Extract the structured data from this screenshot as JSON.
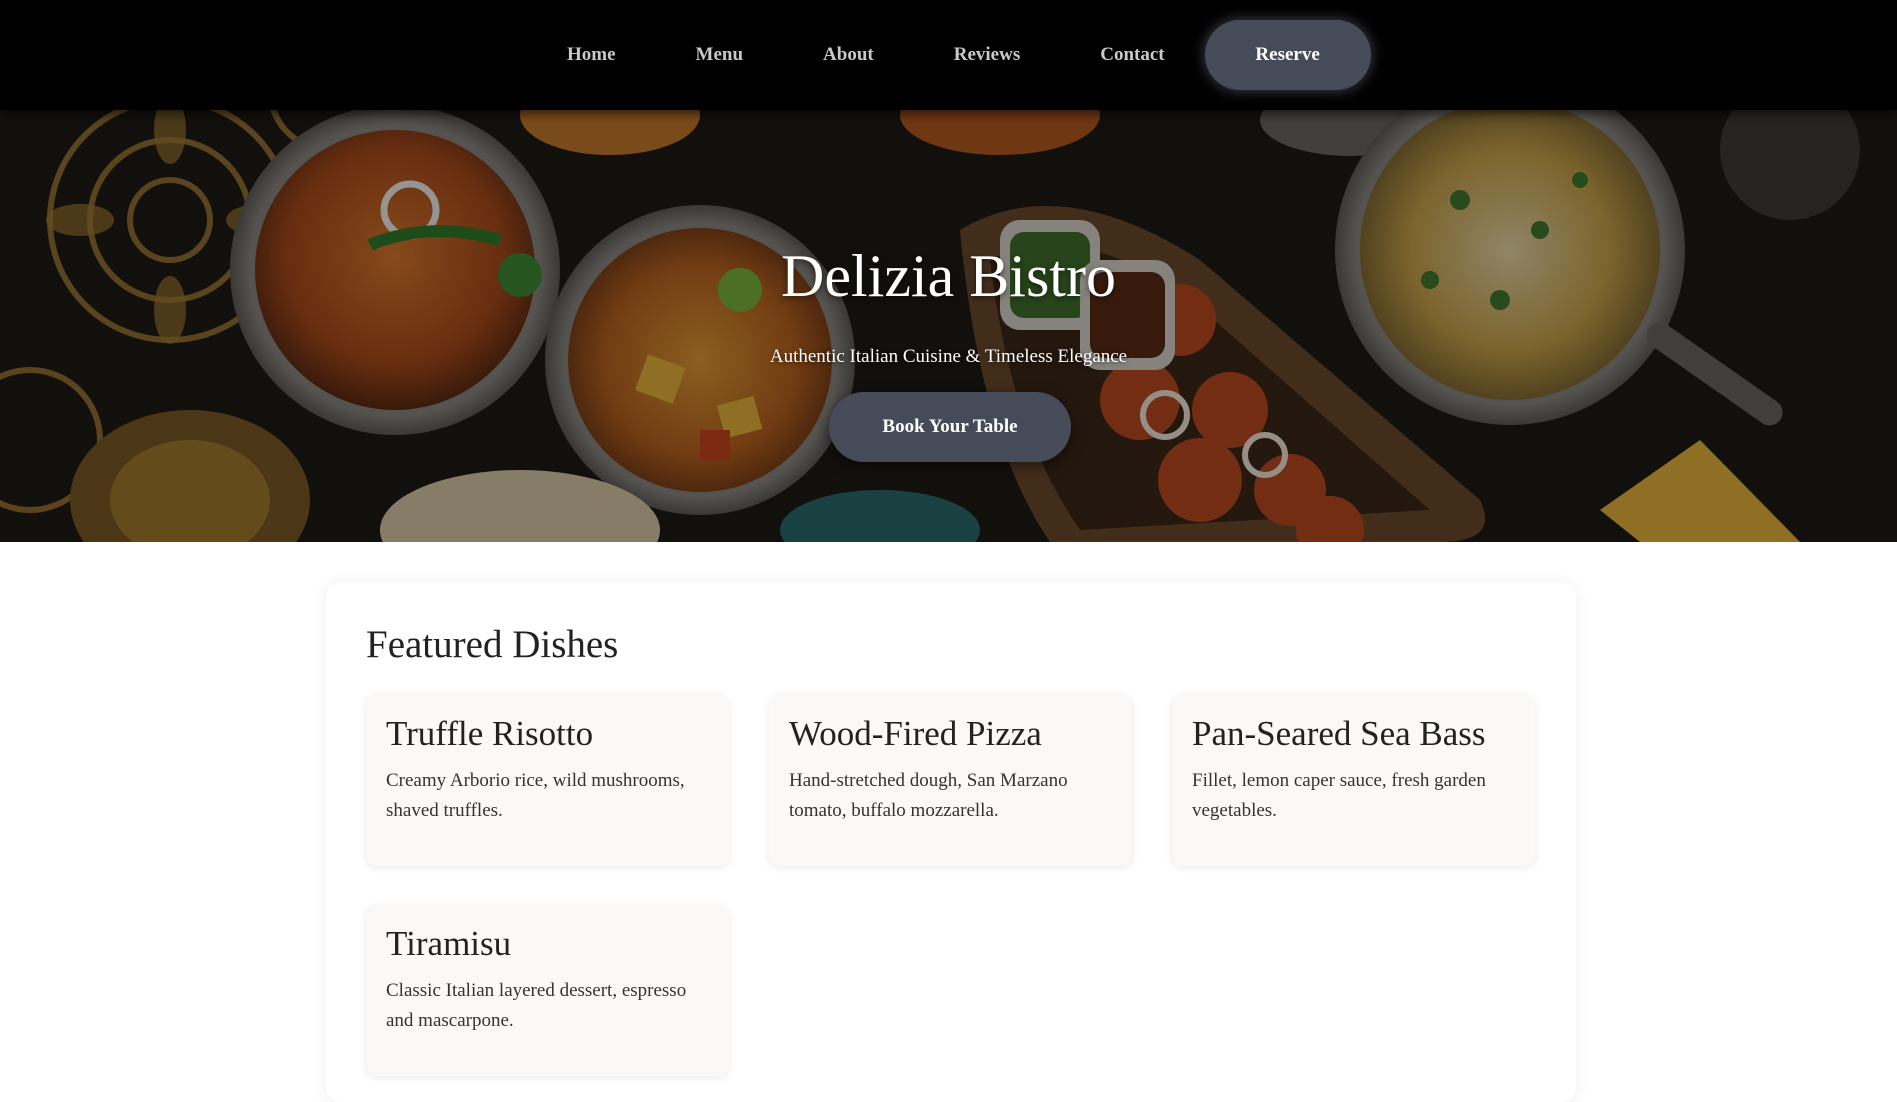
{
  "nav": {
    "items": [
      {
        "label": "Home"
      },
      {
        "label": "Menu"
      },
      {
        "label": "About"
      },
      {
        "label": "Reviews"
      },
      {
        "label": "Contact"
      }
    ],
    "reserve_label": "Reserve"
  },
  "hero": {
    "title": "Delizia Bistro",
    "subtitle": "Authentic Italian Cuisine & Timeless Elegance",
    "cta_label": "Book Your Table"
  },
  "featured": {
    "heading": "Featured Dishes",
    "dishes": [
      {
        "name": "Truffle Risotto",
        "description": "Creamy Arborio rice, wild mushrooms, shaved truffles."
      },
      {
        "name": "Wood-Fired Pizza",
        "description": "Hand-stretched dough, San Marzano tomato, buffalo mozzarella."
      },
      {
        "name": "Pan-Seared Sea Bass",
        "description": "Fillet, lemon caper sauce, fresh garden vegetables."
      },
      {
        "name": "Tiramisu",
        "description": "Classic Italian layered dessert, espresso and mascarpone."
      }
    ]
  },
  "colors": {
    "nav_bg": "#000000",
    "accent_button": "#454b59",
    "card_bg": "#faf9f7"
  }
}
